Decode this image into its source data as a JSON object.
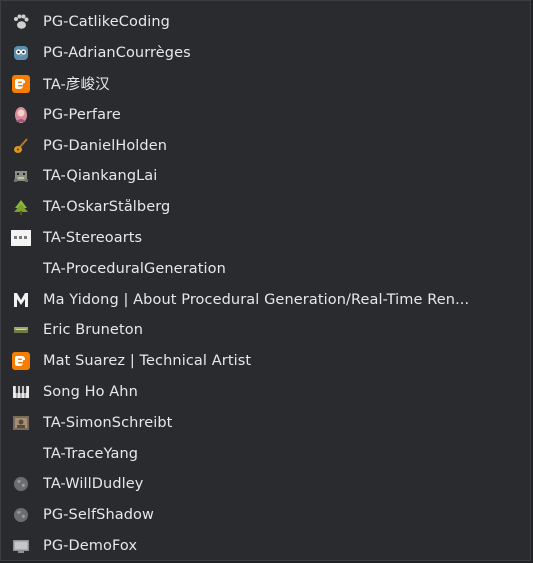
{
  "menu": {
    "items": [
      {
        "label": "PG-CatlikeCoding",
        "icon": "paw-icon"
      },
      {
        "label": "PG-AdrianCourrèges",
        "icon": "owl-icon"
      },
      {
        "label": "TA-彦峻汉",
        "icon": "blogger-icon"
      },
      {
        "label": "PG-Perfare",
        "icon": "avatar-icon"
      },
      {
        "label": "PG-DanielHolden",
        "icon": "guitar-icon"
      },
      {
        "label": "TA-QiankangLai",
        "icon": "pixel-creature-icon"
      },
      {
        "label": "TA-OskarStålberg",
        "icon": "tree-icon"
      },
      {
        "label": "TA-Stereoarts",
        "icon": "stereoarts-icon"
      },
      {
        "label": "TA-ProceduralGeneration",
        "icon": "blank-icon"
      },
      {
        "label": "Ma Yidong | About Procedural Generation/Real-Time Ren...",
        "icon": "m-logo-icon"
      },
      {
        "label": "Eric Bruneton",
        "icon": "landscape-icon"
      },
      {
        "label": "Mat Suarez | Technical Artist",
        "icon": "blogger-icon"
      },
      {
        "label": "Song Ho Ahn",
        "icon": "piano-icon"
      },
      {
        "label": "TA-SimonSchreibt",
        "icon": "photo-icon"
      },
      {
        "label": "TA-TraceYang",
        "icon": "blank-icon"
      },
      {
        "label": "TA-WillDudley",
        "icon": "globe-icon"
      },
      {
        "label": "PG-SelfShadow",
        "icon": "globe-icon"
      },
      {
        "label": "PG-DemoFox",
        "icon": "screen-icon"
      }
    ]
  }
}
